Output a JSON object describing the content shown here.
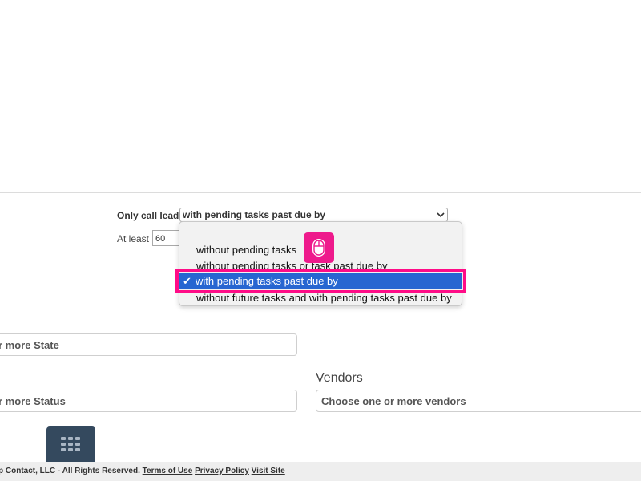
{
  "filter": {
    "only_call_label": "Only call leads",
    "selected_value": "with pending tasks past due by",
    "at_least_label": "At least",
    "at_least_value": "60"
  },
  "dropdown": {
    "options": [
      "without pending tasks",
      "without pending tasks or task past due by",
      "with pending tasks past due by",
      "without future tasks and with pending tasks past due by"
    ],
    "selected_index": 2,
    "check_glyph": "✔"
  },
  "fields": {
    "state_placeholder": "r more State",
    "status_placeholder": "r more Status",
    "vendors_label": "Vendors",
    "vendors_placeholder": "Choose one or more vendors"
  },
  "footer": {
    "copyright": "p Contact, LLC - All Rights Reserved.",
    "terms_link": "Terms of Use",
    "privacy_link": "Privacy Policy",
    "visit_link": "Visit Site"
  },
  "icons": {
    "select_chevron": "chevron-down-icon",
    "mouse_badge": "mouse-icon",
    "grid_button": "grid-icon"
  },
  "colors": {
    "selected_bg": "#2766d1",
    "highlight": "#ff0c87",
    "badge": "#ee1a8c",
    "grid_button": "#34495e"
  }
}
